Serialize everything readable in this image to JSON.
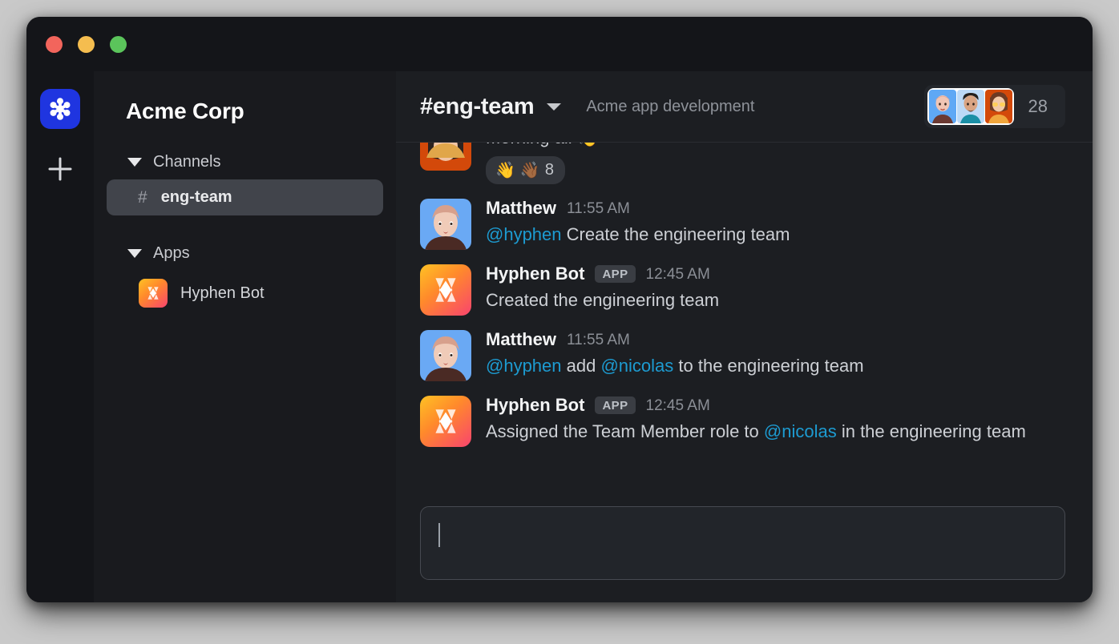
{
  "window": {
    "traffic_lights": [
      "close",
      "minimize",
      "zoom"
    ]
  },
  "rail": {
    "workspace_logo_icon": "asterisk-logo-icon",
    "workspace_logo_color": "#1f35e0",
    "add_workspace_icon": "plus-icon"
  },
  "sidebar": {
    "workspace_name": "Acme Corp",
    "sections": [
      {
        "label": "Channels",
        "caret_icon": "caret-down-icon",
        "channels": [
          {
            "hash": "#",
            "name": "eng-team",
            "active": true
          }
        ]
      },
      {
        "label": "Apps",
        "caret_icon": "caret-down-icon",
        "apps": [
          {
            "name": "Hyphen Bot",
            "icon": "hyphen-bot-icon"
          }
        ]
      }
    ]
  },
  "header": {
    "channel_title": "#eng-team",
    "dropdown_icon": "chevron-down-icon",
    "topic": "Acme app development",
    "member_count": "28",
    "avatars": [
      "member-avatar-1",
      "member-avatar-2",
      "member-avatar-3"
    ]
  },
  "messages": [
    {
      "author": "",
      "time": "",
      "text": "Morning all 👋",
      "clipped": true,
      "avatar": "user-avatar-orange",
      "reaction": {
        "emoji_1": "👋",
        "emoji_2": "👋🏾",
        "count": "8"
      }
    },
    {
      "author": "Matthew",
      "time": "11:55 AM",
      "avatar": "user-avatar-matthew",
      "parts": [
        {
          "type": "mention",
          "text": "@hyphen"
        },
        {
          "type": "plain",
          "text": " Create the engineering team"
        }
      ]
    },
    {
      "author": "Hyphen Bot",
      "badge": "APP",
      "time": "12:45 AM",
      "avatar": "hyphen-bot-icon",
      "parts": [
        {
          "type": "plain",
          "text": "Created the engineering team"
        }
      ]
    },
    {
      "author": "Matthew",
      "time": "11:55 AM",
      "avatar": "user-avatar-matthew",
      "parts": [
        {
          "type": "mention",
          "text": "@hyphen"
        },
        {
          "type": "plain",
          "text": " add "
        },
        {
          "type": "mention",
          "text": "@nicolas"
        },
        {
          "type": "plain",
          "text": " to the engineering team"
        }
      ]
    },
    {
      "author": "Hyphen Bot",
      "badge": "APP",
      "time": "12:45 AM",
      "avatar": "hyphen-bot-icon",
      "parts": [
        {
          "type": "plain",
          "text": "Assigned the Team Member role to "
        },
        {
          "type": "mention",
          "text": "@nicolas"
        },
        {
          "type": "plain",
          "text": " in the engineering team"
        }
      ]
    }
  ],
  "composer": {
    "value": "",
    "placeholder": ""
  },
  "colors": {
    "page_background": "#c9c9c9",
    "window_background": "#1c1e22",
    "sidebar_background": "#191a1e",
    "rail_background": "#141519",
    "active_channel": "#41444b",
    "mention_blue": "#1d9bd1",
    "muted_text": "#8b8f96"
  }
}
